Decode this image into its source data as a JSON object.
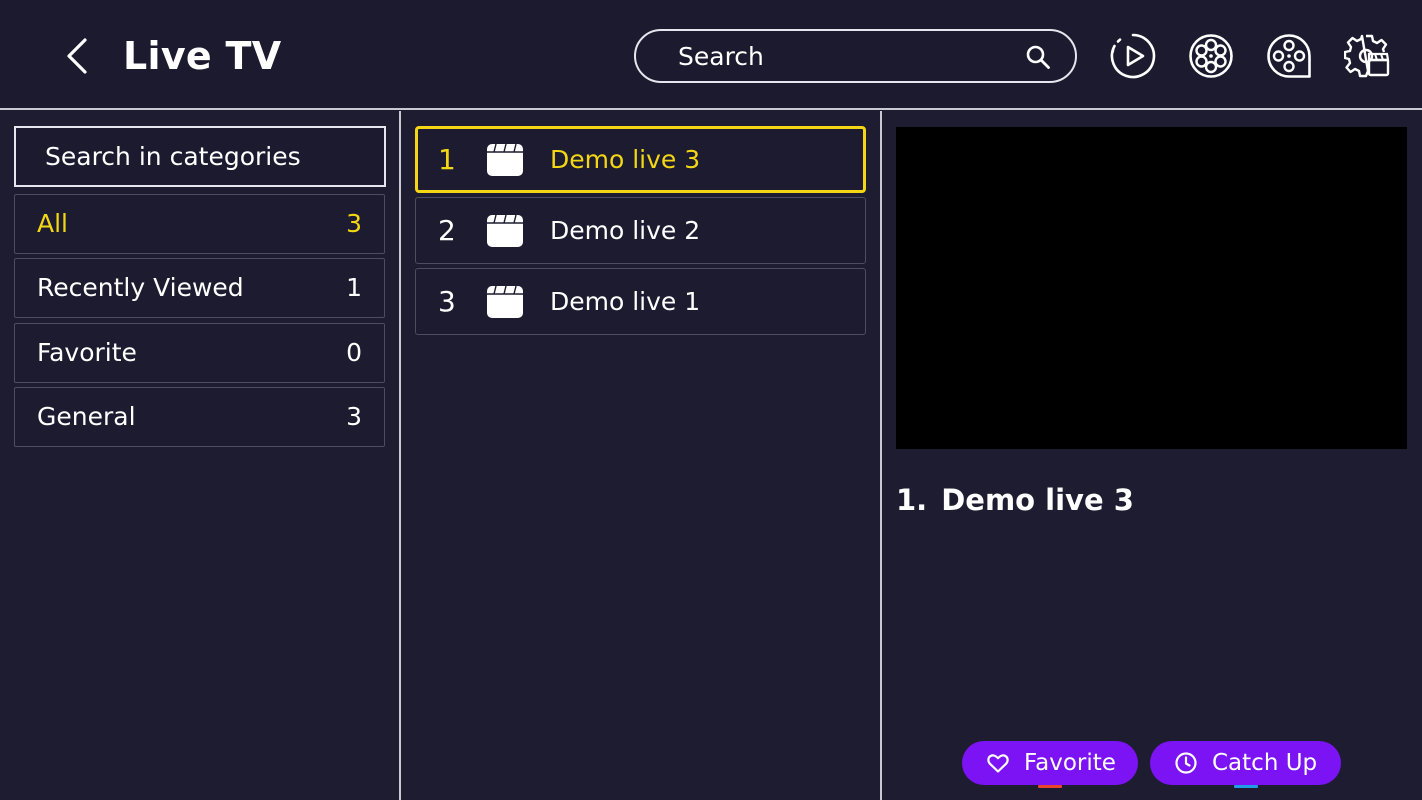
{
  "header": {
    "title": "Live TV",
    "search_placeholder": "Search",
    "icons": [
      "back-arrow-icon",
      "search-icon",
      "play-circle-icon",
      "film-reel-icon",
      "film-reel-tape-icon",
      "settings-clapper-icon"
    ]
  },
  "categories": {
    "search_label": "Search in categories",
    "items": [
      {
        "label": "All",
        "count": "3",
        "active": true
      },
      {
        "label": "Recently Viewed",
        "count": "1",
        "active": false
      },
      {
        "label": "Favorite",
        "count": "0",
        "active": false
      },
      {
        "label": "General",
        "count": "3",
        "active": false
      }
    ]
  },
  "channels": [
    {
      "num": "1",
      "name": "Demo live 3",
      "active": true
    },
    {
      "num": "2",
      "name": "Demo live 2",
      "active": false
    },
    {
      "num": "3",
      "name": "Demo live 1",
      "active": false
    }
  ],
  "preview": {
    "now_playing_num": "1.",
    "now_playing_name": "Demo live 3"
  },
  "actions": {
    "favorite_label": "Favorite",
    "catchup_label": "Catch Up"
  },
  "colors": {
    "background": "#1e1c30",
    "accent_yellow": "#f3d714",
    "button_purple": "#7b13f4",
    "favorite_underline": "#e8452c",
    "catchup_underline": "#1e9ee8"
  }
}
